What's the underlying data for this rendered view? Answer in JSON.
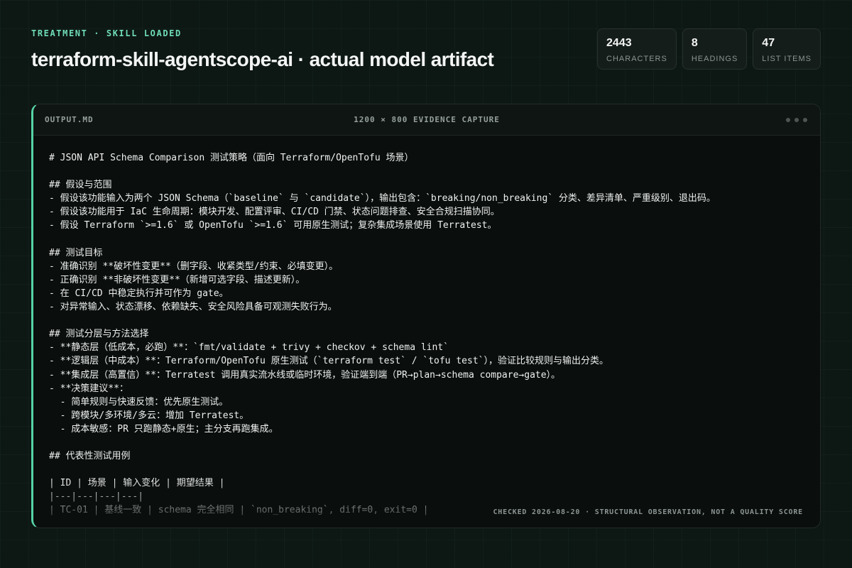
{
  "header": {
    "eyebrow": "TREATMENT · SKILL LOADED",
    "title": "terraform-skill-agentscope-ai · actual model artifact"
  },
  "stats": [
    {
      "value": "2443",
      "label": "CHARACTERS"
    },
    {
      "value": "8",
      "label": "HEADINGS"
    },
    {
      "value": "47",
      "label": "LIST ITEMS"
    }
  ],
  "panel": {
    "filename": "OUTPUT.MD",
    "caption": "1200 × 800 EVIDENCE CAPTURE",
    "footer": "CHECKED 2026-08-20 · STRUCTURAL OBSERVATION, NOT A QUALITY SCORE",
    "content": "# JSON API Schema Comparison 测试策略（面向 Terraform/OpenTofu 场景）\n\n## 假设与范围\n- 假设该功能输入为两个 JSON Schema（`baseline` 与 `candidate`），输出包含：`breaking/non_breaking` 分类、差异清单、严重级别、退出码。\n- 假设该功能用于 IaC 生命周期：模块开发、配置评审、CI/CD 门禁、状态问题排查、安全合规扫描协同。\n- 假设 Terraform `>=1.6` 或 OpenTofu `>=1.6` 可用原生测试；复杂集成场景使用 Terratest。\n\n## 测试目标\n- 准确识别 **破坏性变更**（删字段、收紧类型/约束、必填变更）。\n- 正确识别 **非破坏性变更**（新增可选字段、描述更新）。\n- 在 CI/CD 中稳定执行并可作为 gate。\n- 对异常输入、状态漂移、依赖缺失、安全风险具备可观测失败行为。\n\n## 测试分层与方法选择\n- **静态层（低成本，必跑）**：`fmt/validate + trivy + checkov + schema lint`\n- **逻辑层（中成本）**：Terraform/OpenTofu 原生测试（`terraform test` / `tofu test`），验证比较规则与输出分类。\n- **集成层（高置信）**：Terratest 调用真实流水线或临时环境，验证端到端（PR→plan→schema compare→gate）。\n- **决策建议**：\n  - 简单规则与快速反馈：优先原生测试。\n  - 跨模块/多环境/多云：增加 Terratest。\n  - 成本敏感：PR 只跑静态+原生；主分支再跑集成。\n\n## 代表性测试用例\n\n| ID | 场景 | 输入变化 | 期望结果 |\n|---|---|---|---|\n| TC-01 | 基线一致 | schema 完全相同 | `non_breaking`, diff=0, exit=0 |"
  }
}
